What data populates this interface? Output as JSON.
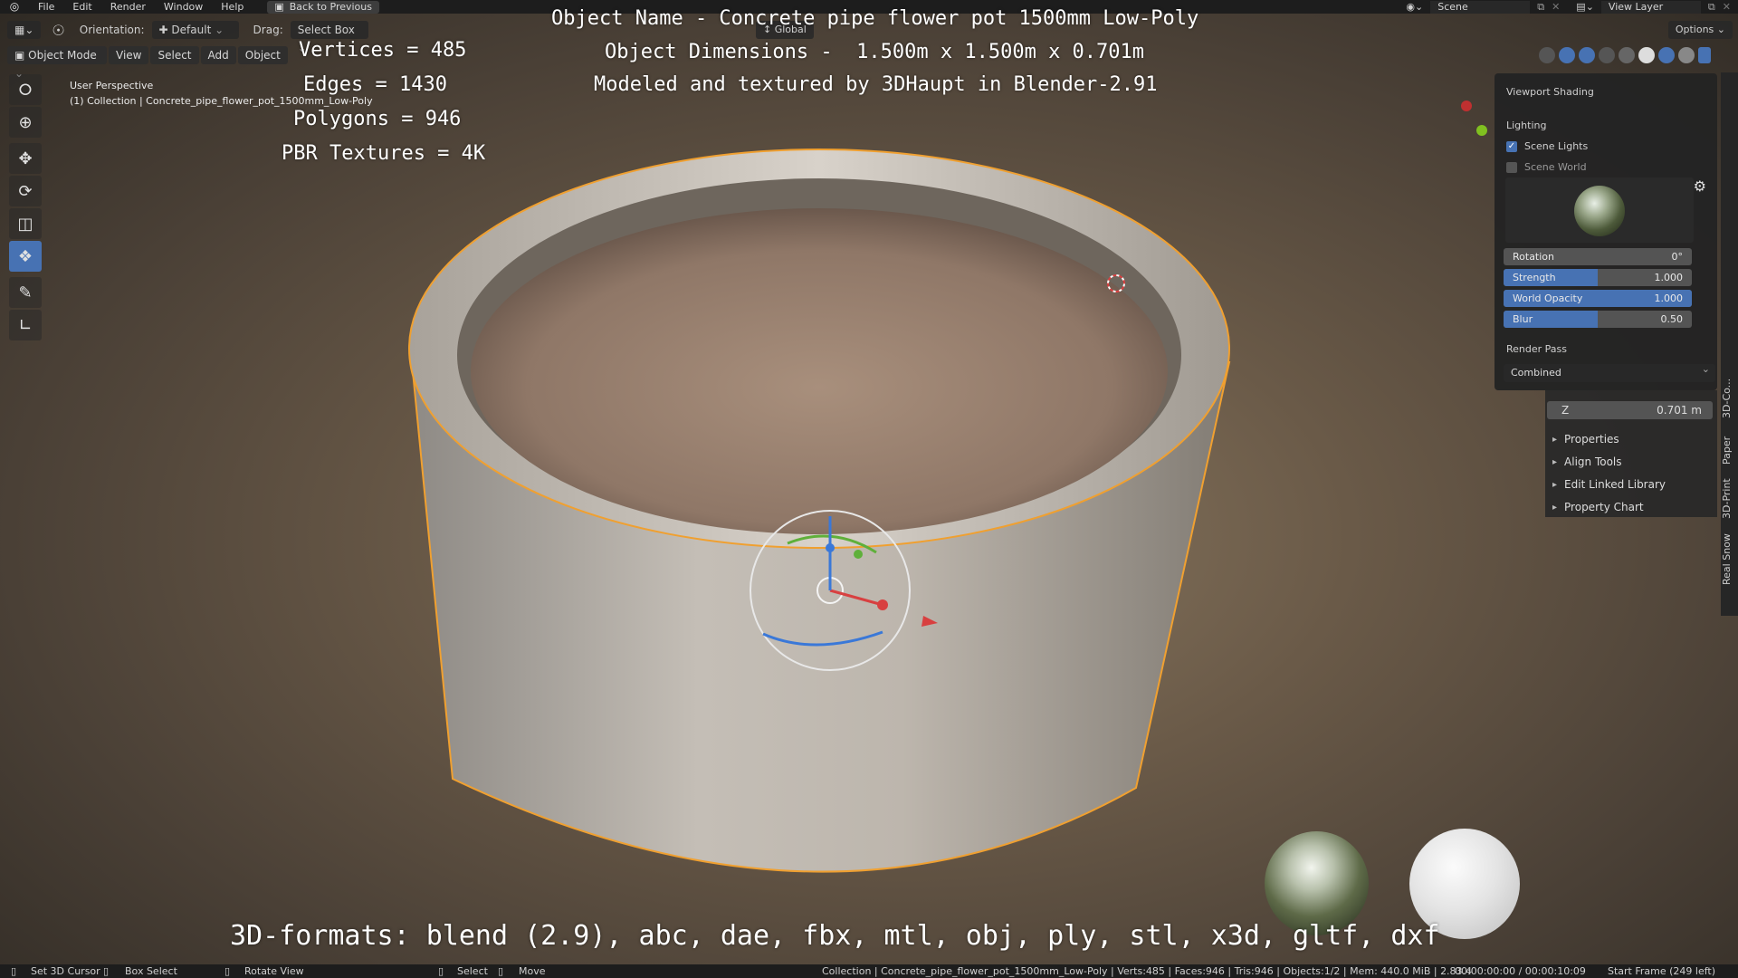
{
  "menubar": {
    "items": [
      "File",
      "Edit",
      "Render",
      "Window",
      "Help"
    ],
    "back_button": "Back to Previous",
    "scene": "Scene",
    "view_layer": "View Layer"
  },
  "header": {
    "orientation_label": "Orientation:",
    "orientation_value": "Default",
    "drag_label": "Drag:",
    "drag_value": "Select Box",
    "transform": "Global",
    "options": "Options",
    "mode": "Object Mode",
    "menus": [
      "View",
      "Select",
      "Add",
      "Object"
    ]
  },
  "viewport": {
    "perspective": "User Perspective",
    "collection_line": "(1) Collection | Concrete_pipe_flower_pot_1500mm_Low-Poly"
  },
  "overlay": {
    "object_name": "Object Name - Concrete pipe flower pot 1500mm Low-Poly",
    "dimensions": "Object Dimensions -  1.500m x 1.500m x 0.701m",
    "credit": "Modeled and textured by 3DHaupt in Blender-2.91",
    "vertices": "Vertices = 485",
    "edges": "Edges = 1430",
    "polygons": "Polygons = 946",
    "textures": "PBR Textures = 4K",
    "formats": "3D-formats: blend (2.9), abc, dae, fbx, mtl, obj, ply, stl, x3d, gltf, dxf"
  },
  "shading_panel": {
    "title": "Viewport Shading",
    "lighting_label": "Lighting",
    "scene_lights": "Scene Lights",
    "scene_lights_checked": true,
    "scene_world": "Scene World",
    "scene_world_checked": false,
    "sliders": [
      {
        "label": "Rotation",
        "value": "0°",
        "fraction": 0
      },
      {
        "label": "Strength",
        "value": "1.000",
        "fraction": 0.5
      },
      {
        "label": "World Opacity",
        "value": "1.000",
        "fraction": 1.0
      },
      {
        "label": "Blur",
        "value": "0.50",
        "fraction": 0.5
      }
    ],
    "render_pass_label": "Render Pass",
    "render_pass_value": "Combined"
  },
  "npanel": {
    "z_label": "Z",
    "z_value": "0.701 m",
    "items": [
      "Properties",
      "Align Tools",
      "Edit Linked Library",
      "Property Chart"
    ],
    "tabs": [
      "3D-Co...",
      "Paper",
      "3D-Print",
      "Real Snow"
    ]
  },
  "statusbar": {
    "set_cursor": "Set 3D Cursor",
    "box_select": "Box Select",
    "rotate_view": "Rotate View",
    "select": "Select",
    "move": "Move",
    "stats": "Collection | Concrete_pipe_flower_pot_1500mm_Low-Poly | Verts:485 | Faces:946 | Tris:946 | Objects:1/2 | Mem: 440.0 MiB | 2.83.4",
    "time": "00:00:00:00 / 00:00:10:09",
    "frame": "Start Frame (249 left)"
  },
  "colors": {
    "accent": "#4772b3",
    "selection_outline": "#f0a030"
  }
}
